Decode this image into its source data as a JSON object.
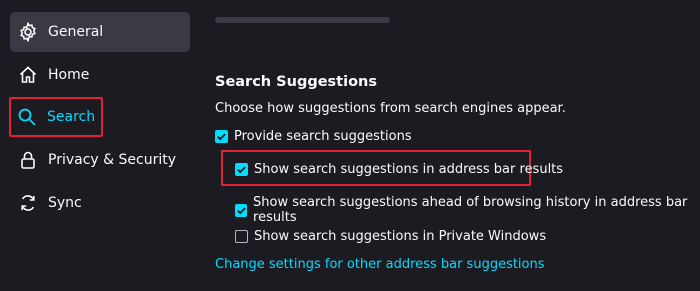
{
  "sidebar": {
    "items": [
      {
        "label": "General",
        "icon": "gear-icon"
      },
      {
        "label": "Home",
        "icon": "home-icon"
      },
      {
        "label": "Search",
        "icon": "search-icon"
      },
      {
        "label": "Privacy & Security",
        "icon": "lock-icon"
      },
      {
        "label": "Sync",
        "icon": "sync-icon"
      }
    ],
    "selected": "General"
  },
  "main": {
    "section_title": "Search Suggestions",
    "section_desc": "Choose how suggestions from search engines appear.",
    "options": [
      {
        "label": "Provide search suggestions",
        "checked": true
      },
      {
        "label": "Show search suggestions in address bar results",
        "checked": true
      },
      {
        "label": "Show search suggestions ahead of browsing history in address bar results",
        "checked": true
      },
      {
        "label": "Show search suggestions in Private Windows",
        "checked": false
      }
    ],
    "link_text": "Change settings for other address bar suggestions"
  },
  "colors": {
    "background": "#1c1b22",
    "accent": "#00ddff",
    "highlight": "#e22233",
    "selected_bg": "#3a3944"
  }
}
